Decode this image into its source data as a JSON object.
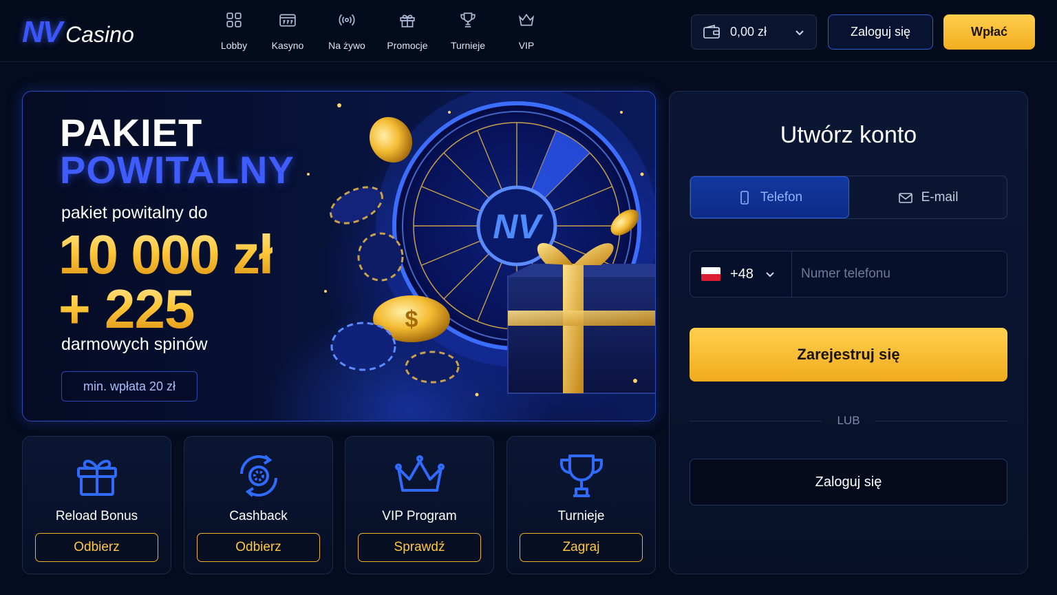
{
  "header": {
    "logo": {
      "mark": "NV",
      "word": "Casino"
    },
    "nav": [
      {
        "label": "Lobby",
        "icon": "grid-icon"
      },
      {
        "label": "Kasyno",
        "icon": "slot-machine-icon"
      },
      {
        "label": "Na żywo",
        "icon": "live-broadcast-icon"
      },
      {
        "label": "Promocje",
        "icon": "gift-icon"
      },
      {
        "label": "Turnieje",
        "icon": "trophy-icon"
      },
      {
        "label": "VIP",
        "icon": "crown-icon"
      }
    ],
    "wallet": {
      "balance": "0,00 zł",
      "icon": "wallet-icon"
    },
    "login_label": "Zaloguj się",
    "deposit_label": "Wpłać"
  },
  "hero": {
    "title_line1": "PAKIET",
    "title_line2": "POWITALNY",
    "subtitle": "pakiet powitalny do",
    "amount": "10 000 zł",
    "spins": "+ 225",
    "spins_label": "darmowych spinów",
    "min_deposit": "min. wpłata 20 zł",
    "wheel_center": "NV",
    "accent_colors": {
      "gold": "#ffc83a",
      "blue": "#3f5cff"
    }
  },
  "cards": [
    {
      "title": "Reload Bonus",
      "button": "Odbierz",
      "icon": "gift-icon"
    },
    {
      "title": "Cashback",
      "button": "Odbierz",
      "icon": "cashback-chip-icon"
    },
    {
      "title": "VIP Program",
      "button": "Sprawdź",
      "icon": "crown-icon"
    },
    {
      "title": "Turnieje",
      "button": "Zagraj",
      "icon": "trophy-icon"
    }
  ],
  "register": {
    "title": "Utwórz konto",
    "tabs": [
      {
        "label": "Telefon",
        "icon": "phone-icon",
        "active": true
      },
      {
        "label": "E-mail",
        "icon": "mail-icon",
        "active": false
      }
    ],
    "phone": {
      "dial_code": "+48",
      "country_flag": "poland-flag-icon",
      "placeholder": "Numer telefonu",
      "value": ""
    },
    "register_label": "Zarejestruj się",
    "divider": "LUB",
    "login_label": "Zaloguj się"
  }
}
